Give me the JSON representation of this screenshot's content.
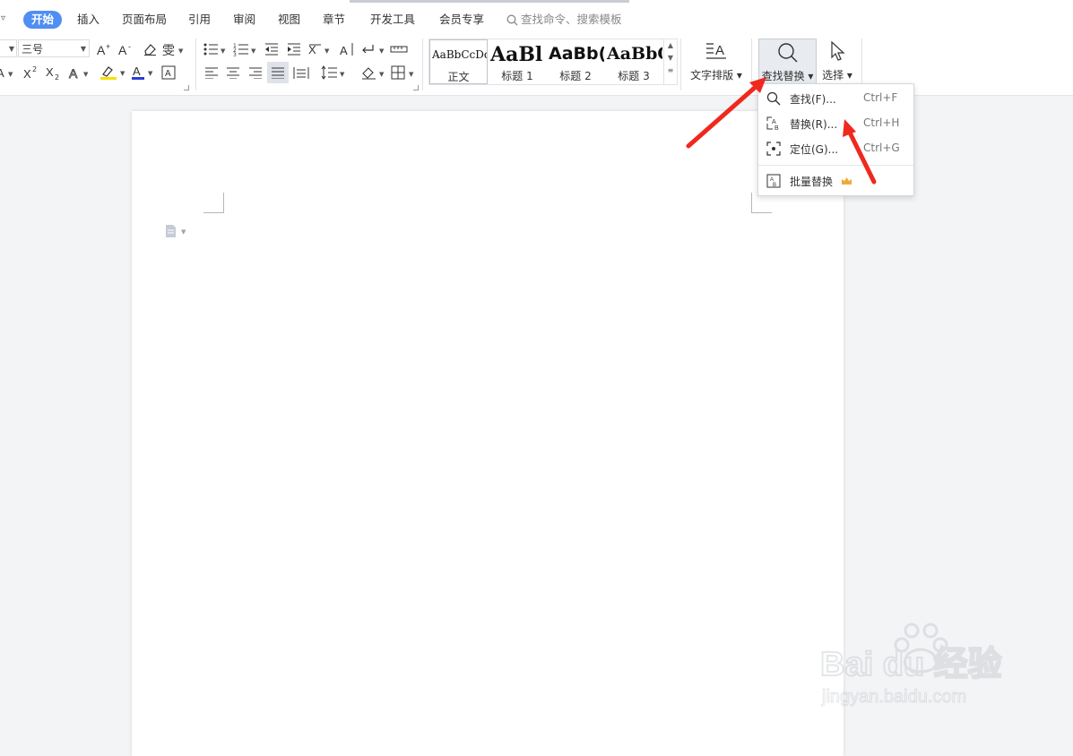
{
  "tabs": {
    "caret": "▿",
    "items": [
      {
        "label": "开始",
        "active": true
      },
      {
        "label": "插入"
      },
      {
        "label": "页面布局"
      },
      {
        "label": "引用"
      },
      {
        "label": "审阅"
      },
      {
        "label": "视图"
      },
      {
        "label": "章节"
      },
      {
        "label": "开发工具"
      },
      {
        "label": "会员专享"
      }
    ],
    "search_placeholder": "查找命令、搜索模板"
  },
  "font": {
    "size_value": "三号"
  },
  "styles": {
    "items": [
      {
        "sample": "AaBbCcDd",
        "name": "正文"
      },
      {
        "sample": "AaBl",
        "name": "标题 1"
      },
      {
        "sample": "AaBb(",
        "name": "标题 2"
      },
      {
        "sample": "AaBbC",
        "name": "标题 3"
      }
    ]
  },
  "buttons": {
    "text_layout": "文字排版",
    "find_replace": "查找替换",
    "select": "选择"
  },
  "menu": {
    "items": [
      {
        "label": "查找(F)...",
        "shortcut": "Ctrl+F",
        "icon": "search-icon"
      },
      {
        "label": "替换(R)...",
        "shortcut": "Ctrl+H",
        "icon": "replace-icon"
      },
      {
        "label": "定位(G)...",
        "shortcut": "Ctrl+G",
        "icon": "goto-icon"
      },
      {
        "label": "批量替换",
        "icon": "batch-replace-icon",
        "badge": "crown-icon"
      }
    ]
  },
  "watermark": {
    "brand": "Bai du 经验",
    "url": "jingyan.baidu.com"
  },
  "colors": {
    "accent": "#4f8ef2",
    "annotation_arrow": "#f0281e",
    "highlight_yellow": "#f5e100",
    "font_color_blue": "#2b3bd6",
    "crown": "#f2a93b"
  }
}
